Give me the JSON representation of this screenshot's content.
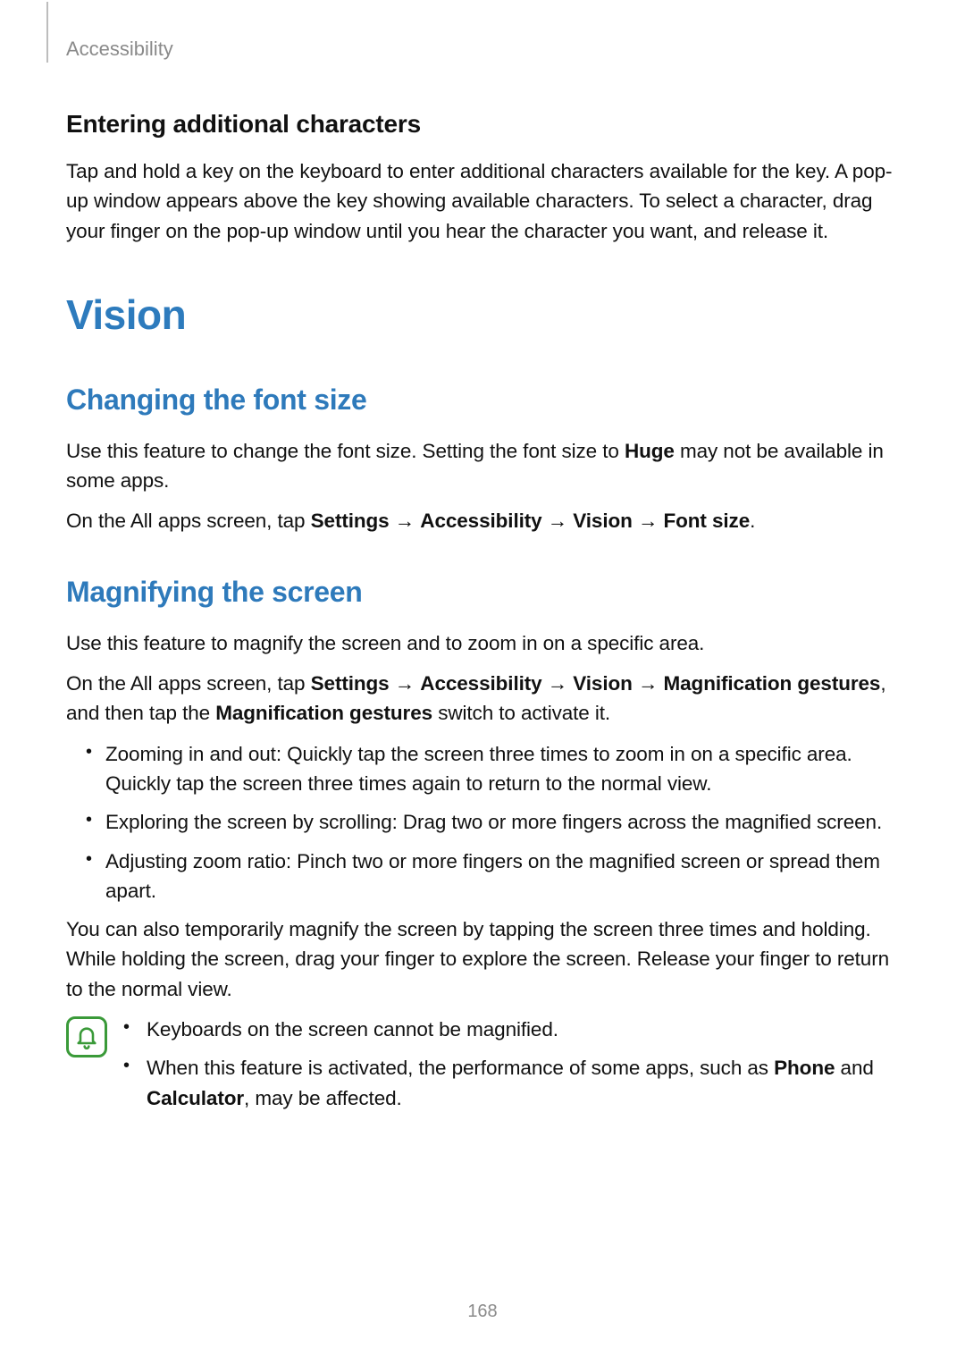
{
  "header": {
    "section": "Accessibility"
  },
  "entering": {
    "title": "Entering additional characters",
    "body": "Tap and hold a key on the keyboard to enter additional characters available for the key. A pop-up window appears above the key showing available characters. To select a character, drag your finger on the pop-up window until you hear the character you want, and release it."
  },
  "vision_title": "Vision",
  "font_size_section": {
    "title": "Changing the font size",
    "p1_a": "Use this feature to change the font size. Setting the font size to ",
    "p1_b_bold": "Huge",
    "p1_c": " may not be available in some apps.",
    "p2_a": "On the All apps screen, tap ",
    "p2_b_bold": "Settings",
    "arrow": " → ",
    "p2_c_bold": "Accessibility",
    "p2_d_bold": "Vision",
    "p2_e_bold": "Font size",
    "period": "."
  },
  "magnify_section": {
    "title": "Magnifying the screen",
    "p1": "Use this feature to magnify the screen and to zoom in on a specific area.",
    "p2_a": "On the All apps screen, tap ",
    "p2_b_bold": "Settings",
    "arrow": " → ",
    "p2_c_bold": "Accessibility",
    "p2_d_bold": "Vision",
    "p2_e_bold": "Magnification gestures",
    "p2_f": ", and then tap the ",
    "p2_g_bold": "Magnification gestures",
    "p2_h": " switch to activate it.",
    "bullets": [
      "Zooming in and out: Quickly tap the screen three times to zoom in on a specific area. Quickly tap the screen three times again to return to the normal view.",
      "Exploring the screen by scrolling: Drag two or more fingers across the magnified screen.",
      "Adjusting zoom ratio: Pinch two or more fingers on the magnified screen or spread them apart."
    ],
    "p3": "You can also temporarily magnify the screen by tapping the screen three times and holding. While holding the screen, drag your finger to explore the screen. Release your finger to return to the normal view.",
    "note1": "Keyboards on the screen cannot be magnified.",
    "note2_a": "When this feature is activated, the performance of some apps, such as ",
    "note2_b_bold": "Phone",
    "note2_c": " and ",
    "note2_d_bold": "Calculator",
    "note2_e": ", may be affected."
  },
  "page_number": "168"
}
